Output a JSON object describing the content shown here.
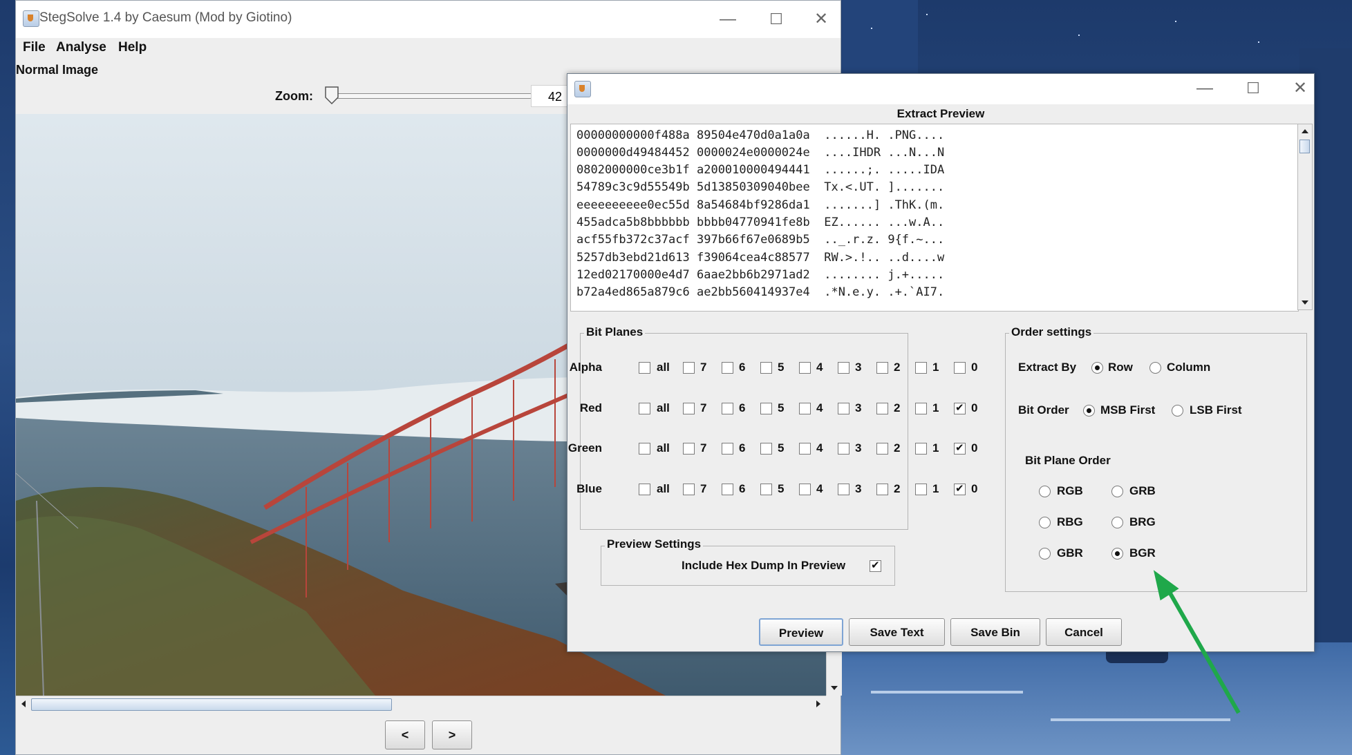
{
  "main_window": {
    "title": "StegSolve 1.4 by Caesum (Mod by Giotino)",
    "menu": [
      "File",
      "Analyse",
      "Help"
    ],
    "image_label": "Normal Image",
    "zoom_label": "Zoom:",
    "zoom_value": "42",
    "prev_label": "<",
    "next_label": ">",
    "controls": {
      "minimize": "—",
      "maximize": "☐",
      "close": "✕"
    }
  },
  "extract_dialog": {
    "heading": "Extract Preview",
    "controls": {
      "minimize": "—",
      "maximize": "☐",
      "close": "✕"
    },
    "hex_lines": [
      "00000000000f488a 89504e470d0a1a0a  ......H. .PNG....",
      "0000000d49484452 0000024e0000024e  ....IHDR ...N...N",
      "0802000000ce3b1f a200010000494441  ......;. .....IDA",
      "54789c3c9d55549b 5d13850309040bee  Tx.<.UT. ].......",
      "eeeeeeeeee0ec55d 8a54684bf9286da1  .......] .ThK.(m.",
      "455adca5b8bbbbbb bbbb04770941fe8b  EZ...... ...w.A..",
      "acf55fb372c37acf 397b66f67e0689b5  .._.r.z. 9{f.~...",
      "5257db3ebd21d613 f39064cea4c88577  RW.>.!.. ..d....w",
      "12ed02170000e4d7 6aae2bb6b2971ad2  ........ j.+.....",
      "b72a4ed865a879c6 ae2bb560414937e4  .*N.e.y. .+.`AI7."
    ],
    "bit_planes": {
      "title": "Bit Planes",
      "all_label": "all",
      "bit_labels": [
        "7",
        "6",
        "5",
        "4",
        "3",
        "2",
        "1",
        "0"
      ],
      "rows": [
        {
          "name": "Alpha",
          "all": false,
          "bits": [
            false,
            false,
            false,
            false,
            false,
            false,
            false,
            false
          ]
        },
        {
          "name": "Red",
          "all": false,
          "bits": [
            false,
            false,
            false,
            false,
            false,
            false,
            false,
            true
          ]
        },
        {
          "name": "Green",
          "all": false,
          "bits": [
            false,
            false,
            false,
            false,
            false,
            false,
            false,
            true
          ]
        },
        {
          "name": "Blue",
          "all": false,
          "bits": [
            false,
            false,
            false,
            false,
            false,
            false,
            false,
            true
          ]
        }
      ]
    },
    "preview_settings": {
      "title": "Preview Settings",
      "include_hex_label": "Include Hex Dump In Preview",
      "include_hex_checked": true
    },
    "order_settings": {
      "title": "Order settings",
      "extract_by_label": "Extract By",
      "extract_by_options": [
        "Row",
        "Column"
      ],
      "extract_by_selected": "Row",
      "bit_order_label": "Bit Order",
      "bit_order_options": [
        "MSB First",
        "LSB First"
      ],
      "bit_order_selected": "MSB First",
      "bit_plane_order_label": "Bit Plane Order",
      "bit_plane_order_options": [
        "RGB",
        "GRB",
        "RBG",
        "BRG",
        "GBR",
        "BGR"
      ],
      "bit_plane_order_selected": "BGR"
    },
    "buttons": [
      "Preview",
      "Save Text",
      "Save Bin",
      "Cancel"
    ]
  },
  "colors": {
    "annotation_arrow": "#1fa84a",
    "desktop_blue": "#2b4f86"
  }
}
